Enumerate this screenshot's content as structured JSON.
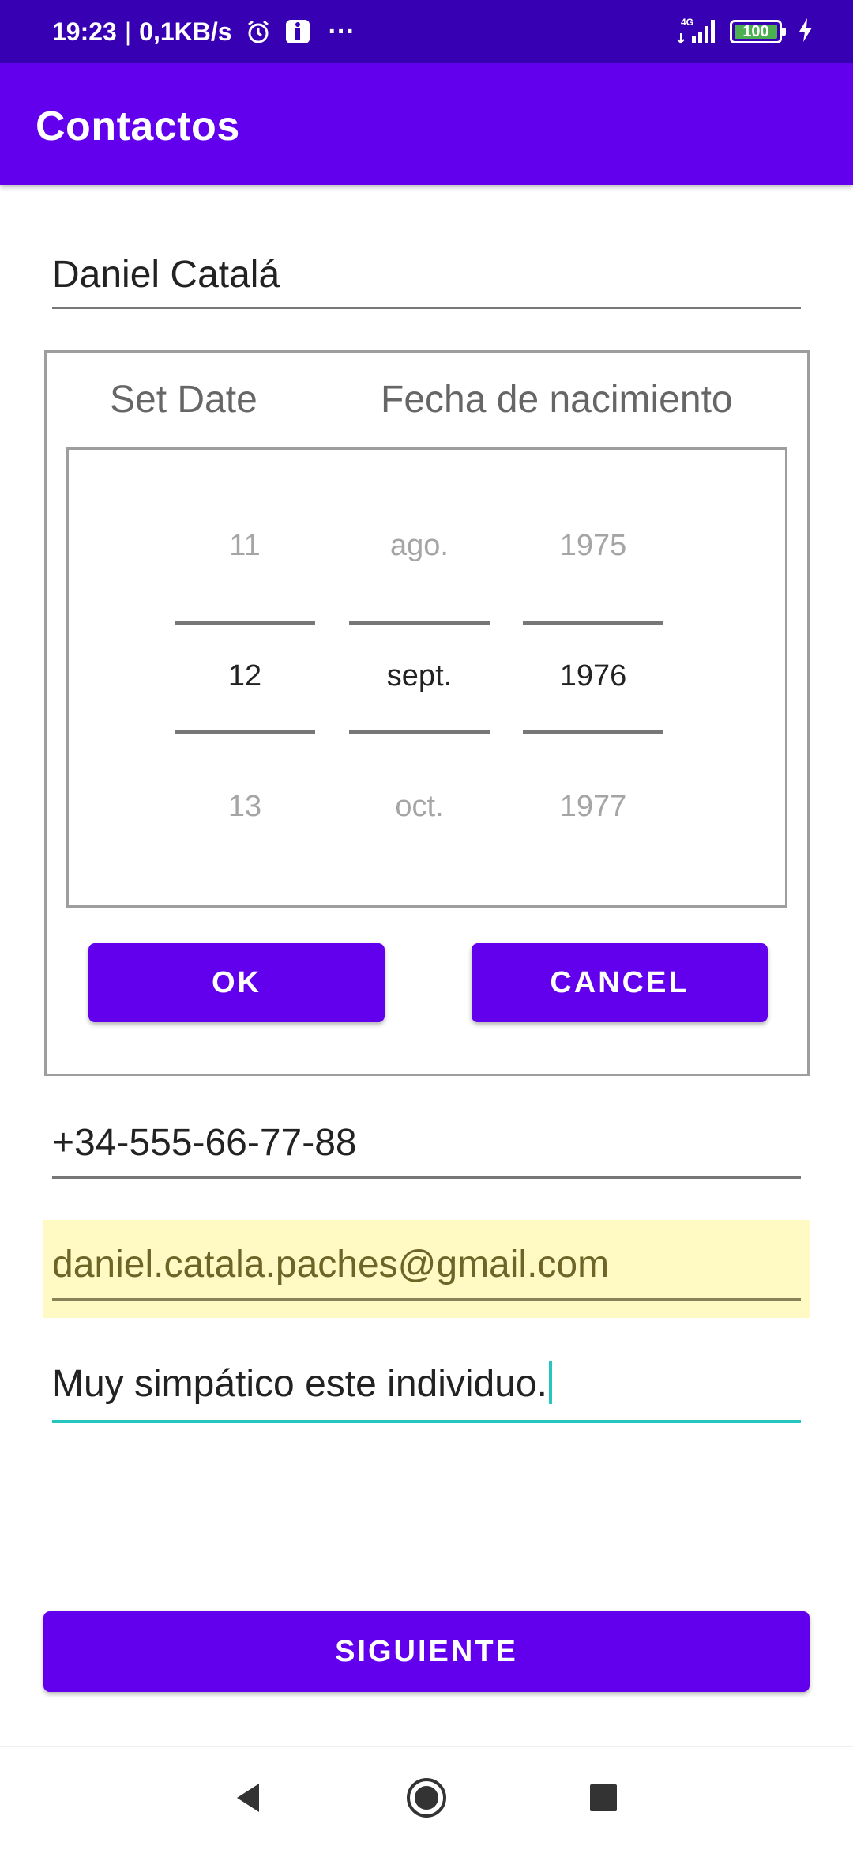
{
  "status_bar": {
    "time": "19:23",
    "separator": "|",
    "speed": "0,1KB/s",
    "more": "···",
    "network": "4G",
    "battery": "100",
    "icons": [
      "alarm-icon",
      "notification-app-icon",
      "signal-icon",
      "battery-icon",
      "charging-icon"
    ]
  },
  "app_bar": {
    "title": "Contactos"
  },
  "form": {
    "name_value": "Daniel Catalá",
    "phone_value": "+34-555-66-77-88",
    "email_value": "daniel.catala.paches@gmail.com",
    "notes_value": "Muy simpático este individuo."
  },
  "date_picker": {
    "set_date_label": "Set Date",
    "caption": "Fecha de nacimiento",
    "day": {
      "prev": "11",
      "current": "12",
      "next": "13"
    },
    "month": {
      "prev": "ago.",
      "current": "sept.",
      "next": "oct."
    },
    "year": {
      "prev": "1975",
      "current": "1976",
      "next": "1977"
    },
    "ok_label": "OK",
    "cancel_label": "CANCEL"
  },
  "next_button_label": "SIGUIENTE",
  "nav_bar": {
    "icons": [
      "back-icon",
      "home-icon",
      "recents-icon"
    ]
  },
  "colors": {
    "status_bar": "#3700b3",
    "primary": "#6200ee",
    "autofill_bg": "#fff9c4",
    "focus_accent": "#26c6c0"
  }
}
